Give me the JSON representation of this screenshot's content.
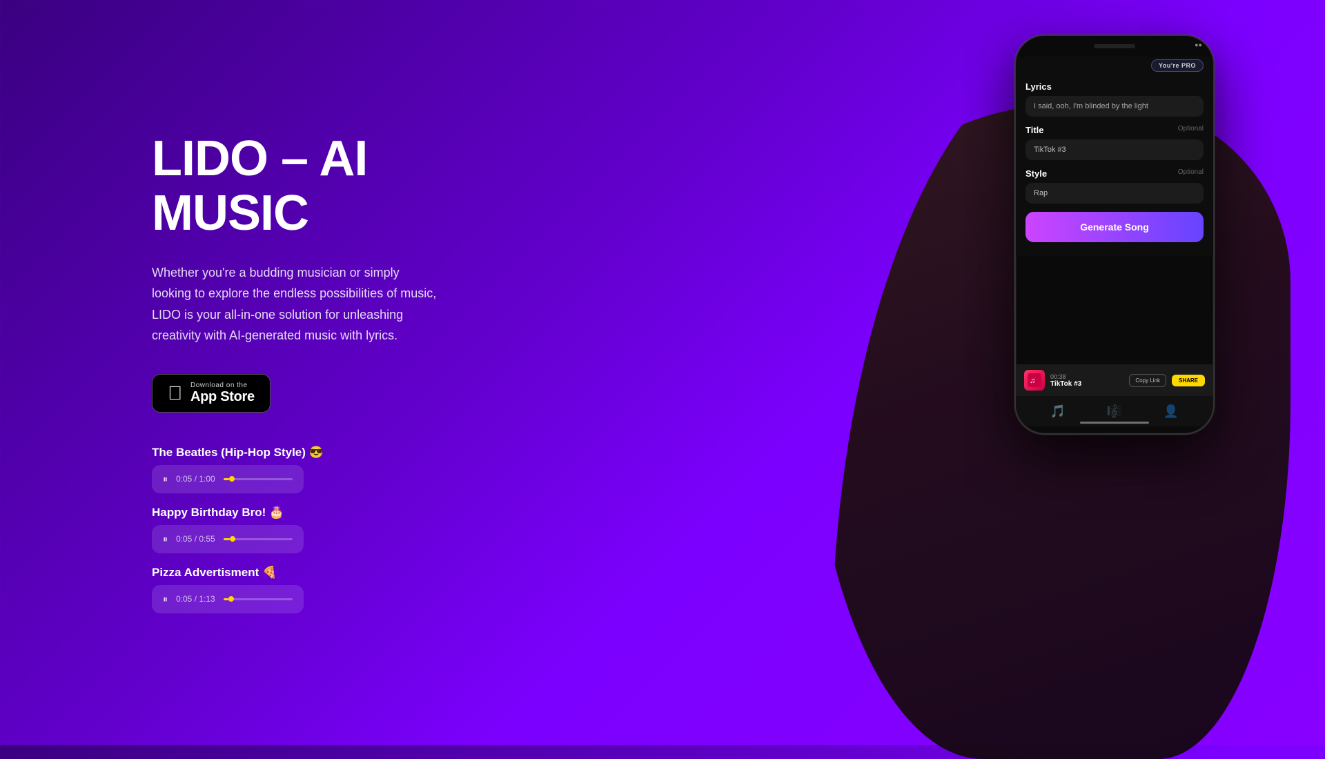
{
  "hero": {
    "title_line1": "LIDO – AI",
    "title_line2": "MUSIC",
    "description": "Whether you're a budding musician or simply looking to explore the endless possibilities of music, LIDO is your all-in-one solution for unleashing creativity with AI-generated music with lyrics.",
    "app_store": {
      "download_text": "Download on the",
      "store_name": "App Store"
    }
  },
  "songs": [
    {
      "title": "The Beatles (Hip-Hop Style) 😎",
      "current_time": "0:05",
      "total_time": "1:00",
      "progress_pct": 8
    },
    {
      "title": "Happy Birthday Bro! 🎂",
      "current_time": "0:05",
      "total_time": "0:55",
      "progress_pct": 9
    },
    {
      "title": "Pizza Advertisment 🍕",
      "current_time": "0:05",
      "total_time": "1:13",
      "progress_pct": 7
    }
  ],
  "phone": {
    "pro_badge": "You're PRO",
    "lyrics_label": "Lyrics",
    "lyrics_placeholder": "I said, ooh, I'm blinded by the light",
    "title_label": "Title",
    "title_optional": "Optional",
    "title_value": "TikTok #3",
    "style_label": "Style",
    "style_optional": "Optional",
    "style_value": "Rap",
    "generate_btn": "Generate Song",
    "now_playing": {
      "time": "00:38",
      "title": "TikTok #3",
      "copy_link": "Copy Link",
      "share": "SHARE"
    }
  },
  "colors": {
    "bg_gradient_start": "#3a0080",
    "bg_gradient_end": "#8800ff",
    "generate_btn_start": "#cc44ff",
    "generate_btn_end": "#6644ff",
    "accent_yellow": "#ffd700"
  }
}
